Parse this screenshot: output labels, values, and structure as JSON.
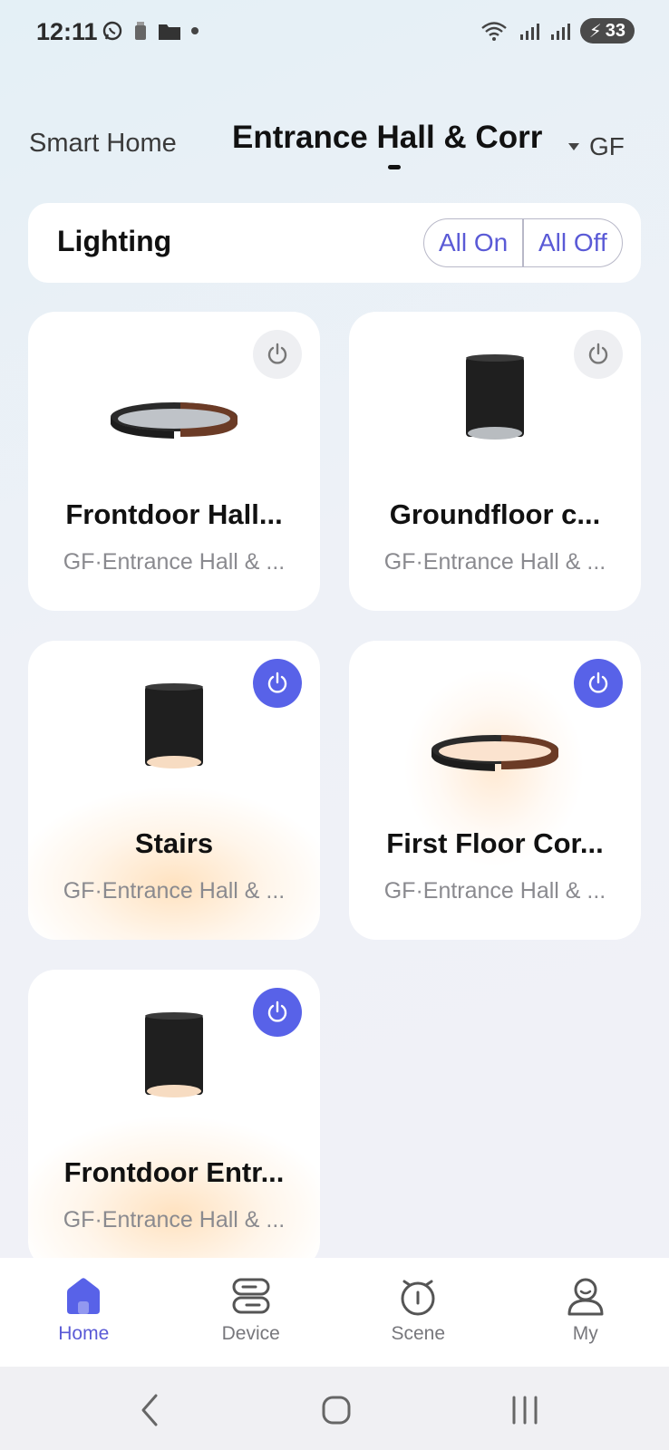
{
  "status_bar": {
    "time": "12:11",
    "battery": "33"
  },
  "header": {
    "tab_home": "Smart Home",
    "tab_room": "Entrance Hall & Corr",
    "floor": "GF"
  },
  "lighting": {
    "title": "Lighting",
    "all_on": "All On",
    "all_off": "All Off"
  },
  "devices": [
    {
      "name": "Frontdoor Hall...",
      "location": "GF·Entrance Hall & ...",
      "power": "off",
      "type": "ring"
    },
    {
      "name": "Groundfloor c...",
      "location": "GF·Entrance Hall & ...",
      "power": "off",
      "type": "cylinder"
    },
    {
      "name": "Stairs",
      "location": "GF·Entrance Hall & ...",
      "power": "on",
      "type": "cylinder"
    },
    {
      "name": "First Floor Cor...",
      "location": "GF·Entrance Hall & ...",
      "power": "on",
      "type": "ring"
    },
    {
      "name": "Frontdoor Entr...",
      "location": "GF·Entrance Hall & ...",
      "power": "on",
      "type": "cylinder"
    }
  ],
  "nav": {
    "home": "Home",
    "device": "Device",
    "scene": "Scene",
    "my": "My"
  },
  "colors": {
    "accent": "#5a5ad6",
    "power_on": "#5862e8"
  }
}
